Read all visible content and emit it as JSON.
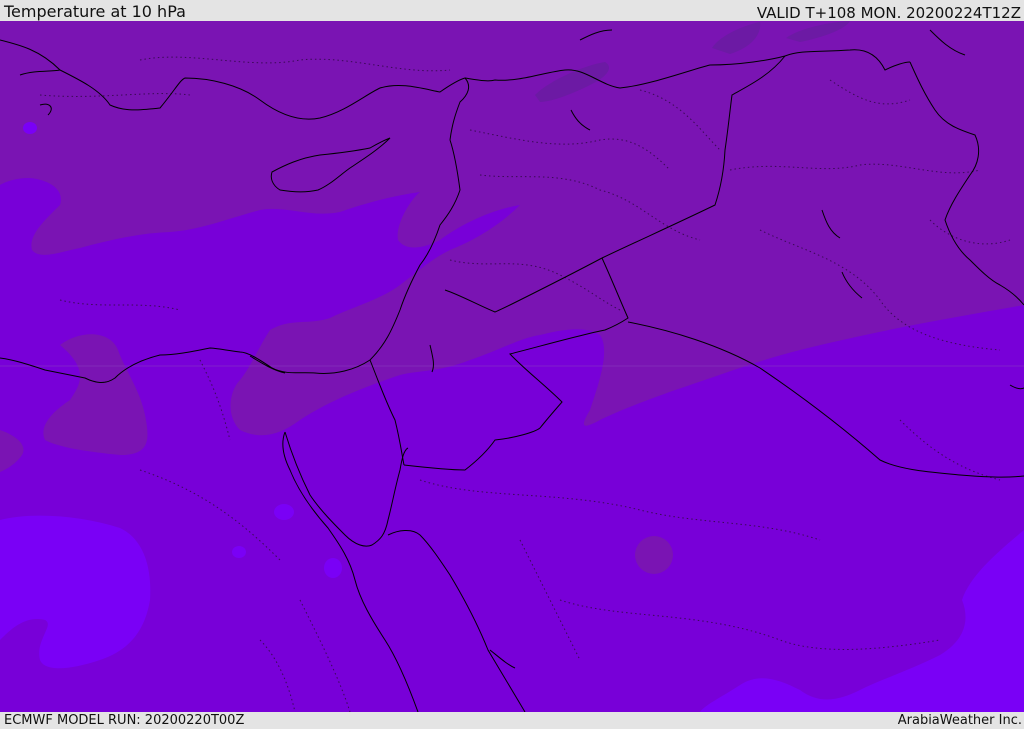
{
  "header": {
    "title": "Temperature at 10 hPa",
    "valid": "VALID T+108 MON. 20200224T12Z"
  },
  "footer": {
    "model_run": "ECMWF MODEL RUN: 20200220T00Z",
    "credit": "ArabiaWeather Inc."
  },
  "colors": {
    "band_warm": "#7a13b2",
    "band_mid": "#7700d6",
    "band_cold": "#7a00f6",
    "band_warmest": "#6e1aa3",
    "coastline": "#000000",
    "border_dotted": "#3a0a55"
  }
}
